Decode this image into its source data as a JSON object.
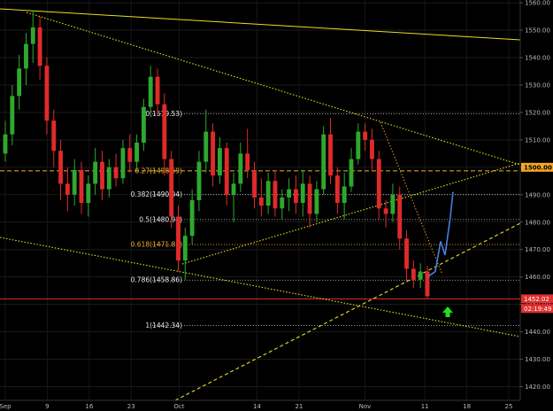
{
  "chart_data": {
    "type": "candlestick",
    "y_axis": {
      "ticks": [
        1420,
        1430,
        1440,
        1450,
        1460,
        1470,
        1480,
        1490,
        1500,
        1510,
        1520,
        1530,
        1540,
        1550,
        1560
      ],
      "tick_labels": [
        "1420.00",
        "1430.00",
        "1440.00",
        "1450.00",
        "1460.00",
        "1470.00",
        "1480.00",
        "1490.00",
        "1500.00",
        "1510.00",
        "1520.00",
        "1530.00",
        "1540.00",
        "1550.00",
        "1560.00"
      ],
      "range": [
        1415,
        1561
      ],
      "position": "right"
    },
    "x_axis": {
      "labels": [
        "Sep",
        "9",
        "16",
        "23",
        "Oct",
        "14",
        "21",
        "Nov",
        "11",
        "18",
        "25"
      ],
      "dates": [
        "2019-09-02",
        "2019-09-09",
        "2019-09-16",
        "2019-09-23",
        "2019-10-01",
        "2019-10-14",
        "2019-10-21",
        "2019-11-01",
        "2019-11-11",
        "2019-11-18",
        "2019-11-25"
      ]
    },
    "price_tags": [
      {
        "value": 1500.0,
        "label": "1500.00",
        "color": "#f5a623"
      },
      {
        "value": 1452.02,
        "label": "1452.02",
        "color": "#e03030"
      },
      {
        "value": 1448.5,
        "label": "02:19:49",
        "color": "#e03030"
      }
    ],
    "fib_levels": [
      {
        "ratio": "0",
        "value": 1519.53,
        "label": "0(1519.53)",
        "color": "#cccccc",
        "style": "dotted"
      },
      {
        "ratio": "0.27",
        "value": 1498.69,
        "label": "0.27(1498.69)",
        "color": "#f0b030",
        "style": "dashed"
      },
      {
        "ratio": "0.382",
        "value": 1490.04,
        "label": "0.382(1490.04)",
        "color": "#cccccc",
        "style": "dotted"
      },
      {
        "ratio": "0.5",
        "value": 1480.94,
        "label": "0.5(1480.94)",
        "color": "#cccccc",
        "style": "dotted"
      },
      {
        "ratio": "0.618",
        "value": 1471.83,
        "label": "0.618(1471.83)",
        "color": "#f0b030",
        "style": "dotted"
      },
      {
        "ratio": "0.786",
        "value": 1458.86,
        "label": "0.786(1458.86)",
        "color": "#cccccc",
        "style": "dotted"
      },
      {
        "ratio": "1",
        "value": 1442.34,
        "label": "1(1442.34)",
        "color": "#cccccc",
        "style": "dotted"
      }
    ],
    "current_price_line": {
      "value": 1452.02,
      "color": "#e03030"
    },
    "colors": {
      "bull": "#2fa82f",
      "bear": "#e02a2a",
      "trend": "#e8e020",
      "projection": "#4a7fd8",
      "arrow": "#20e020"
    },
    "candles": [
      {
        "o": 1505,
        "h": 1517,
        "l": 1502,
        "c": 1512
      },
      {
        "o": 1512,
        "h": 1530,
        "l": 1508,
        "c": 1526
      },
      {
        "o": 1526,
        "h": 1541,
        "l": 1521,
        "c": 1536
      },
      {
        "o": 1536,
        "h": 1549,
        "l": 1530,
        "c": 1545
      },
      {
        "o": 1545,
        "h": 1557,
        "l": 1538,
        "c": 1551
      },
      {
        "o": 1551,
        "h": 1555,
        "l": 1532,
        "c": 1537
      },
      {
        "o": 1537,
        "h": 1540,
        "l": 1512,
        "c": 1517
      },
      {
        "o": 1517,
        "h": 1521,
        "l": 1500,
        "c": 1506
      },
      {
        "o": 1506,
        "h": 1510,
        "l": 1488,
        "c": 1494
      },
      {
        "o": 1494,
        "h": 1500,
        "l": 1484,
        "c": 1490
      },
      {
        "o": 1490,
        "h": 1503,
        "l": 1486,
        "c": 1499
      },
      {
        "o": 1499,
        "h": 1502,
        "l": 1483,
        "c": 1487
      },
      {
        "o": 1487,
        "h": 1497,
        "l": 1482,
        "c": 1494
      },
      {
        "o": 1494,
        "h": 1507,
        "l": 1490,
        "c": 1502
      },
      {
        "o": 1502,
        "h": 1506,
        "l": 1488,
        "c": 1492
      },
      {
        "o": 1492,
        "h": 1503,
        "l": 1489,
        "c": 1500
      },
      {
        "o": 1500,
        "h": 1505,
        "l": 1493,
        "c": 1496
      },
      {
        "o": 1496,
        "h": 1510,
        "l": 1494,
        "c": 1507
      },
      {
        "o": 1507,
        "h": 1512,
        "l": 1498,
        "c": 1502
      },
      {
        "o": 1502,
        "h": 1512,
        "l": 1499,
        "c": 1509
      },
      {
        "o": 1509,
        "h": 1525,
        "l": 1506,
        "c": 1522
      },
      {
        "o": 1522,
        "h": 1537,
        "l": 1519,
        "c": 1533
      },
      {
        "o": 1533,
        "h": 1536,
        "l": 1519,
        "c": 1523
      },
      {
        "o": 1523,
        "h": 1527,
        "l": 1497,
        "c": 1503
      },
      {
        "o": 1503,
        "h": 1506,
        "l": 1478,
        "c": 1482
      },
      {
        "o": 1482,
        "h": 1486,
        "l": 1462,
        "c": 1466
      },
      {
        "o": 1466,
        "h": 1478,
        "l": 1459,
        "c": 1475
      },
      {
        "o": 1475,
        "h": 1492,
        "l": 1472,
        "c": 1488
      },
      {
        "o": 1488,
        "h": 1506,
        "l": 1484,
        "c": 1502
      },
      {
        "o": 1502,
        "h": 1521,
        "l": 1498,
        "c": 1513
      },
      {
        "o": 1513,
        "h": 1516,
        "l": 1493,
        "c": 1497
      },
      {
        "o": 1497,
        "h": 1511,
        "l": 1494,
        "c": 1507
      },
      {
        "o": 1507,
        "h": 1509,
        "l": 1486,
        "c": 1490
      },
      {
        "o": 1490,
        "h": 1498,
        "l": 1480,
        "c": 1494
      },
      {
        "o": 1494,
        "h": 1509,
        "l": 1491,
        "c": 1505
      },
      {
        "o": 1505,
        "h": 1514,
        "l": 1496,
        "c": 1499
      },
      {
        "o": 1499,
        "h": 1502,
        "l": 1485,
        "c": 1489
      },
      {
        "o": 1489,
        "h": 1496,
        "l": 1482,
        "c": 1486
      },
      {
        "o": 1486,
        "h": 1498,
        "l": 1483,
        "c": 1495
      },
      {
        "o": 1495,
        "h": 1499,
        "l": 1482,
        "c": 1485
      },
      {
        "o": 1485,
        "h": 1492,
        "l": 1481,
        "c": 1489
      },
      {
        "o": 1489,
        "h": 1496,
        "l": 1484,
        "c": 1492
      },
      {
        "o": 1492,
        "h": 1497,
        "l": 1483,
        "c": 1487
      },
      {
        "o": 1487,
        "h": 1499,
        "l": 1482,
        "c": 1494
      },
      {
        "o": 1494,
        "h": 1497,
        "l": 1478,
        "c": 1483
      },
      {
        "o": 1483,
        "h": 1495,
        "l": 1480,
        "c": 1492
      },
      {
        "o": 1492,
        "h": 1515,
        "l": 1490,
        "c": 1512
      },
      {
        "o": 1512,
        "h": 1518,
        "l": 1494,
        "c": 1497
      },
      {
        "o": 1497,
        "h": 1500,
        "l": 1483,
        "c": 1487
      },
      {
        "o": 1487,
        "h": 1498,
        "l": 1481,
        "c": 1493
      },
      {
        "o": 1493,
        "h": 1507,
        "l": 1491,
        "c": 1503
      },
      {
        "o": 1503,
        "h": 1516,
        "l": 1501,
        "c": 1513
      },
      {
        "o": 1513,
        "h": 1516,
        "l": 1506,
        "c": 1510
      },
      {
        "o": 1510,
        "h": 1514,
        "l": 1499,
        "c": 1503
      },
      {
        "o": 1503,
        "h": 1506,
        "l": 1481,
        "c": 1485
      },
      {
        "o": 1485,
        "h": 1488,
        "l": 1478,
        "c": 1483
      },
      {
        "o": 1483,
        "h": 1494,
        "l": 1480,
        "c": 1490
      },
      {
        "o": 1490,
        "h": 1493,
        "l": 1470,
        "c": 1474
      },
      {
        "o": 1474,
        "h": 1477,
        "l": 1458,
        "c": 1463
      },
      {
        "o": 1463,
        "h": 1466,
        "l": 1456,
        "c": 1459
      },
      {
        "o": 1459,
        "h": 1465,
        "l": 1456,
        "c": 1462
      },
      {
        "o": 1462,
        "h": 1464,
        "l": 1452,
        "c": 1453
      }
    ],
    "projection": [
      1460,
      1462,
      1473,
      1468,
      1482,
      1491
    ],
    "trendlines": [
      {
        "name": "outer-resistance",
        "style": "solid"
      },
      {
        "name": "descending-resistance",
        "style": "dotted"
      },
      {
        "name": "lower-channel",
        "style": "dotted"
      },
      {
        "name": "rising-channel",
        "style": "dotted"
      },
      {
        "name": "rising-support",
        "style": "dashed"
      },
      {
        "name": "fib-diagonal",
        "style": "dotted"
      }
    ]
  }
}
